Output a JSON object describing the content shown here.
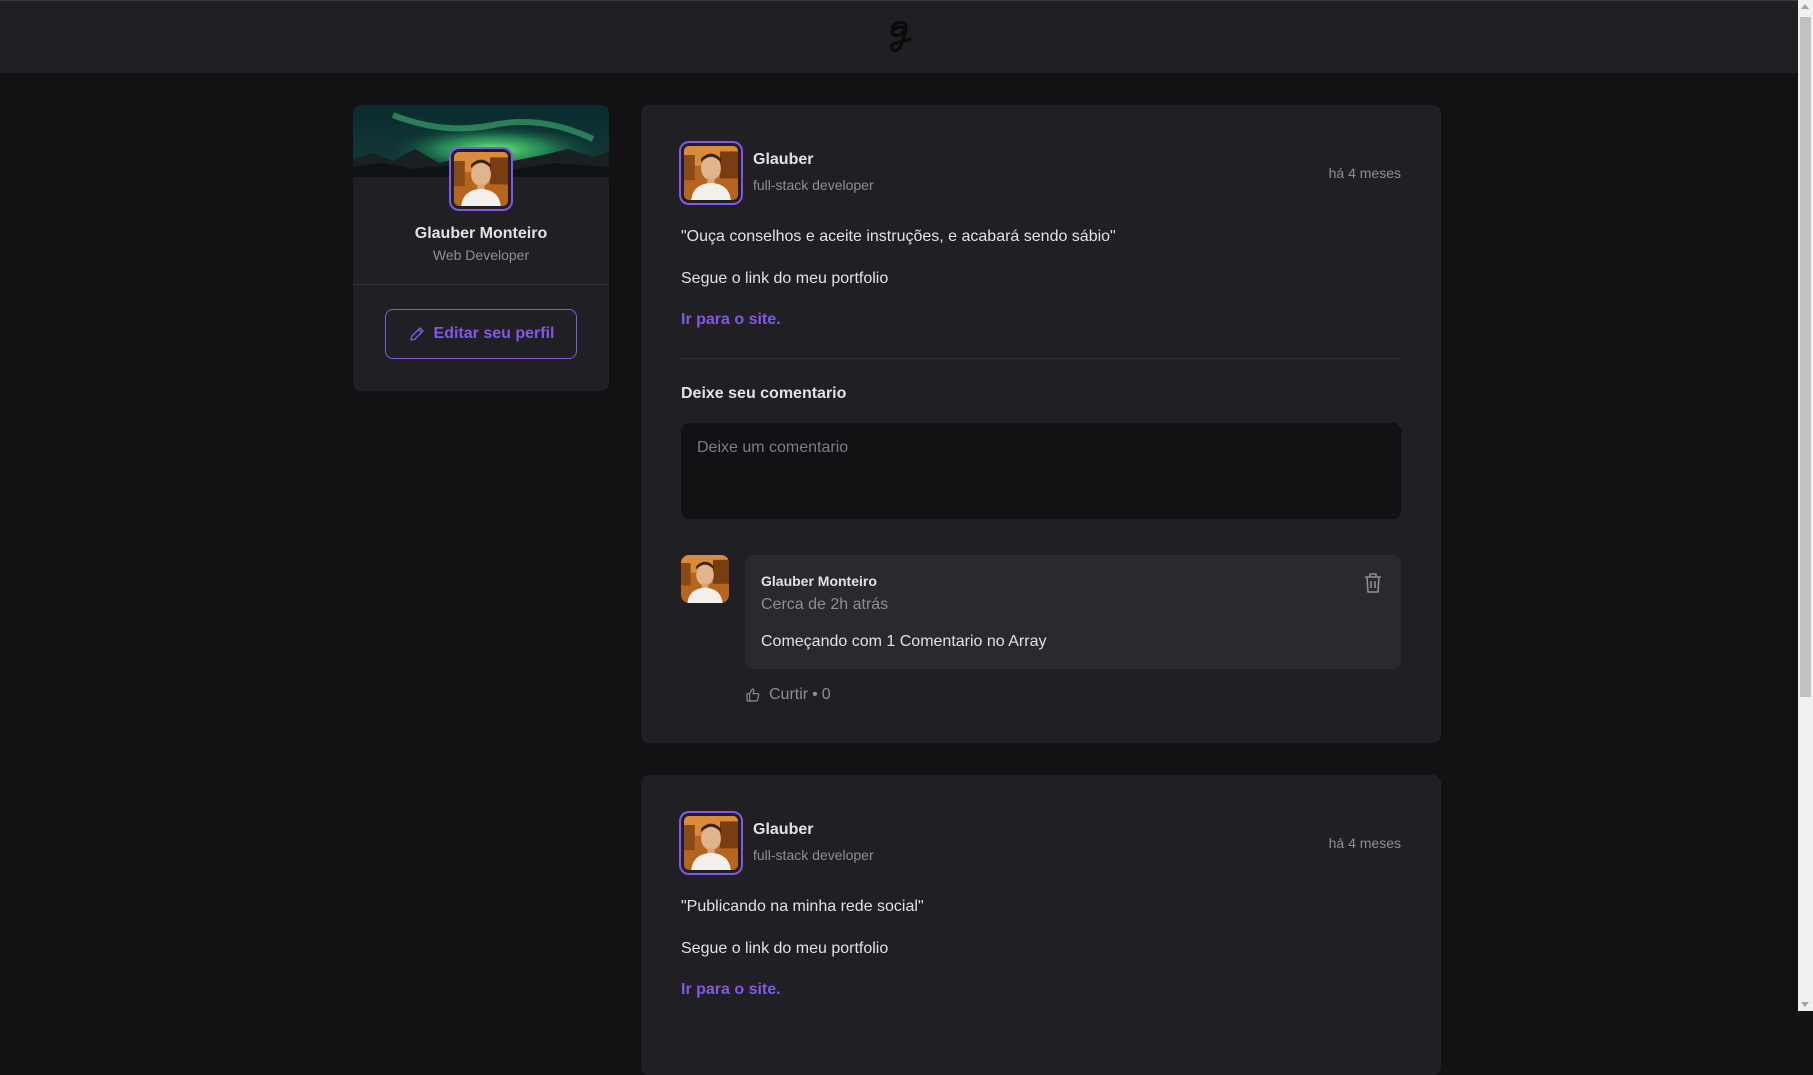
{
  "header": {
    "logo_icon": "g-logo-icon"
  },
  "sidebar": {
    "name": "Glauber Monteiro",
    "role": "Web Developer",
    "edit_button_label": "Editar seu perfil",
    "edit_icon": "pencil-icon"
  },
  "posts": [
    {
      "author_name": "Glauber",
      "author_role": "full-stack developer",
      "time": "há 4 meses",
      "quote": "\"Ouça conselhos e aceite instruções, e acabará sendo sábio\"",
      "text": "Segue o link do meu portfolio",
      "link": "Ir para o site.",
      "comment_form": {
        "title": "Deixe seu comentario",
        "placeholder": "Deixe um comentario"
      },
      "comments": [
        {
          "author": "Glauber Monteiro",
          "time": "Cerca de 2h atrás",
          "text": "Começando com 1 Comentario no Array",
          "like_label": "Curtir",
          "like_separator": "•",
          "likes": "0"
        }
      ]
    },
    {
      "author_name": "Glauber",
      "author_role": "full-stack developer",
      "time": "há 4 meses",
      "quote": "\"Publicando na minha rede social\"",
      "text": "Segue o link do meu portfolio",
      "link": "Ir para o site."
    }
  ],
  "colors": {
    "accent": "#8257e5",
    "background": "#121214",
    "surface": "#202024",
    "comment_surface": "#29292e"
  }
}
